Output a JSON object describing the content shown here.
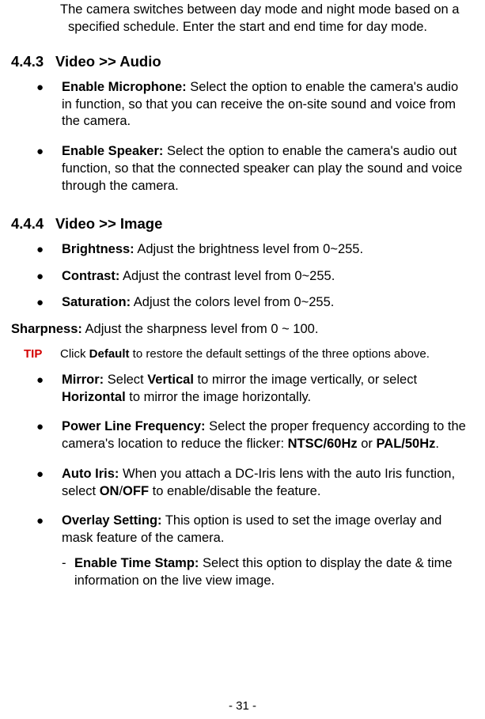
{
  "intro": "The camera switches between day mode and night mode based on a specified schedule. Enter the start and end time for day mode.",
  "section_audio": {
    "number": "4.4.3",
    "title": "Video >> Audio",
    "items": [
      {
        "label": "Enable Microphone:",
        "body": " Select the option to enable the camera's audio in function, so that you can receive the on-site sound and voice from the camera."
      },
      {
        "label": "Enable Speaker:",
        "body": " Select the option to enable the camera's audio out function, so that the connected speaker can play the sound and voice through the camera."
      }
    ]
  },
  "section_image": {
    "number": "4.4.4",
    "title": "Video >> Image",
    "items_top": [
      {
        "label": "Brightness:",
        "body": " Adjust the brightness level from 0~255."
      },
      {
        "label": "Contrast:",
        "body": " Adjust the contrast level from 0~255."
      },
      {
        "label": "Saturation:",
        "body": " Adjust the colors level from 0~255."
      }
    ],
    "sharpness_label": "Sharpness:",
    "sharpness_body": " Adjust the sharpness level from 0 ~ 100.",
    "tip_label": "TIP",
    "tip_pre": "Click ",
    "tip_bold": "Default",
    "tip_post": " to restore the default settings of the three options above.",
    "mirror": {
      "label": "Mirror:",
      "mid1": " Select ",
      "b1": "Vertical",
      "mid2": " to mirror the image vertically, or select ",
      "b2": "Horizontal",
      "mid3": " to mirror the image horizontally."
    },
    "plf": {
      "label": "Power Line Frequency:",
      "mid1": " Select the proper frequency according to the camera's location to reduce the flicker: ",
      "b1": "NTSC/60Hz",
      "mid2": " or ",
      "b2": "PAL/50Hz",
      "mid3": "."
    },
    "autoiris": {
      "label": "Auto Iris:",
      "mid1": " When you attach a DC-Iris lens with the auto Iris function, select ",
      "b1": "ON",
      "mid2": "/",
      "b2": "OFF",
      "mid3": " to enable/disable the feature."
    },
    "overlay": {
      "label": "Overlay Setting:",
      "body": " This option is used to set the image overlay and mask feature of the camera."
    },
    "timestamp": {
      "label": "Enable Time Stamp:",
      "body": " Select this option to display the date & time information on the live view image."
    }
  },
  "page_number": "- 31 -"
}
